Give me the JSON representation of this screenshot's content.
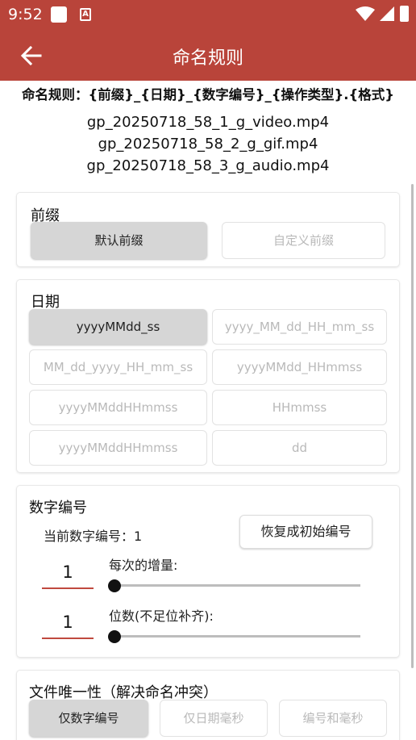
{
  "status": {
    "time": "9:52",
    "notif_icon": "app-notification-icon",
    "a_icon_text": "A"
  },
  "appbar": {
    "title": "命名规则",
    "back_icon": "arrow-left-icon"
  },
  "rule": {
    "pattern": "命名规则：{前缀}_{日期}_{数字编号}_{操作类型}.{格式}",
    "examples": [
      "gp_20250718_58_1_g_video.mp4",
      "gp_20250718_58_2_g_gif.mp4",
      "gp_20250718_58_3_g_audio.mp4"
    ]
  },
  "prefix": {
    "title": "前缀",
    "options": [
      {
        "label": "默认前缀",
        "selected": true
      },
      {
        "label": "自定义前缀",
        "selected": false
      }
    ]
  },
  "date": {
    "title": "日期",
    "options": [
      {
        "label": "yyyyMMdd_ss",
        "selected": true
      },
      {
        "label": "yyyy_MM_dd_HH_mm_ss",
        "selected": false
      },
      {
        "label": "MM_dd_yyyy_HH_mm_ss",
        "selected": false
      },
      {
        "label": "yyyyMMdd_HHmmss",
        "selected": false
      },
      {
        "label": "yyyyMMddHHmmss",
        "selected": false
      },
      {
        "label": "HHmmss",
        "selected": false
      },
      {
        "label": "yyyyMMddHHmmss",
        "selected": false
      },
      {
        "label": "dd",
        "selected": false
      }
    ]
  },
  "number": {
    "title": "数字编号",
    "current_label": "当前数字编号：1",
    "reset_button": "恢复成初始编号",
    "increment": {
      "value": "1",
      "label": "每次的增量:",
      "slider_fraction": 0.0
    },
    "digits": {
      "value": "1",
      "label": "位数(不足位补齐):",
      "slider_fraction": 0.0
    }
  },
  "uniqueness": {
    "title": "文件唯一性（解决命名冲突）",
    "options": [
      {
        "label": "仅数字编号",
        "selected": true
      },
      {
        "label": "仅日期毫秒",
        "selected": false
      },
      {
        "label": "编号和毫秒",
        "selected": false
      }
    ]
  },
  "colors": {
    "accent": "#b9443a",
    "selected_bg": "#d6d6d6",
    "input_underline": "#c0493f"
  }
}
